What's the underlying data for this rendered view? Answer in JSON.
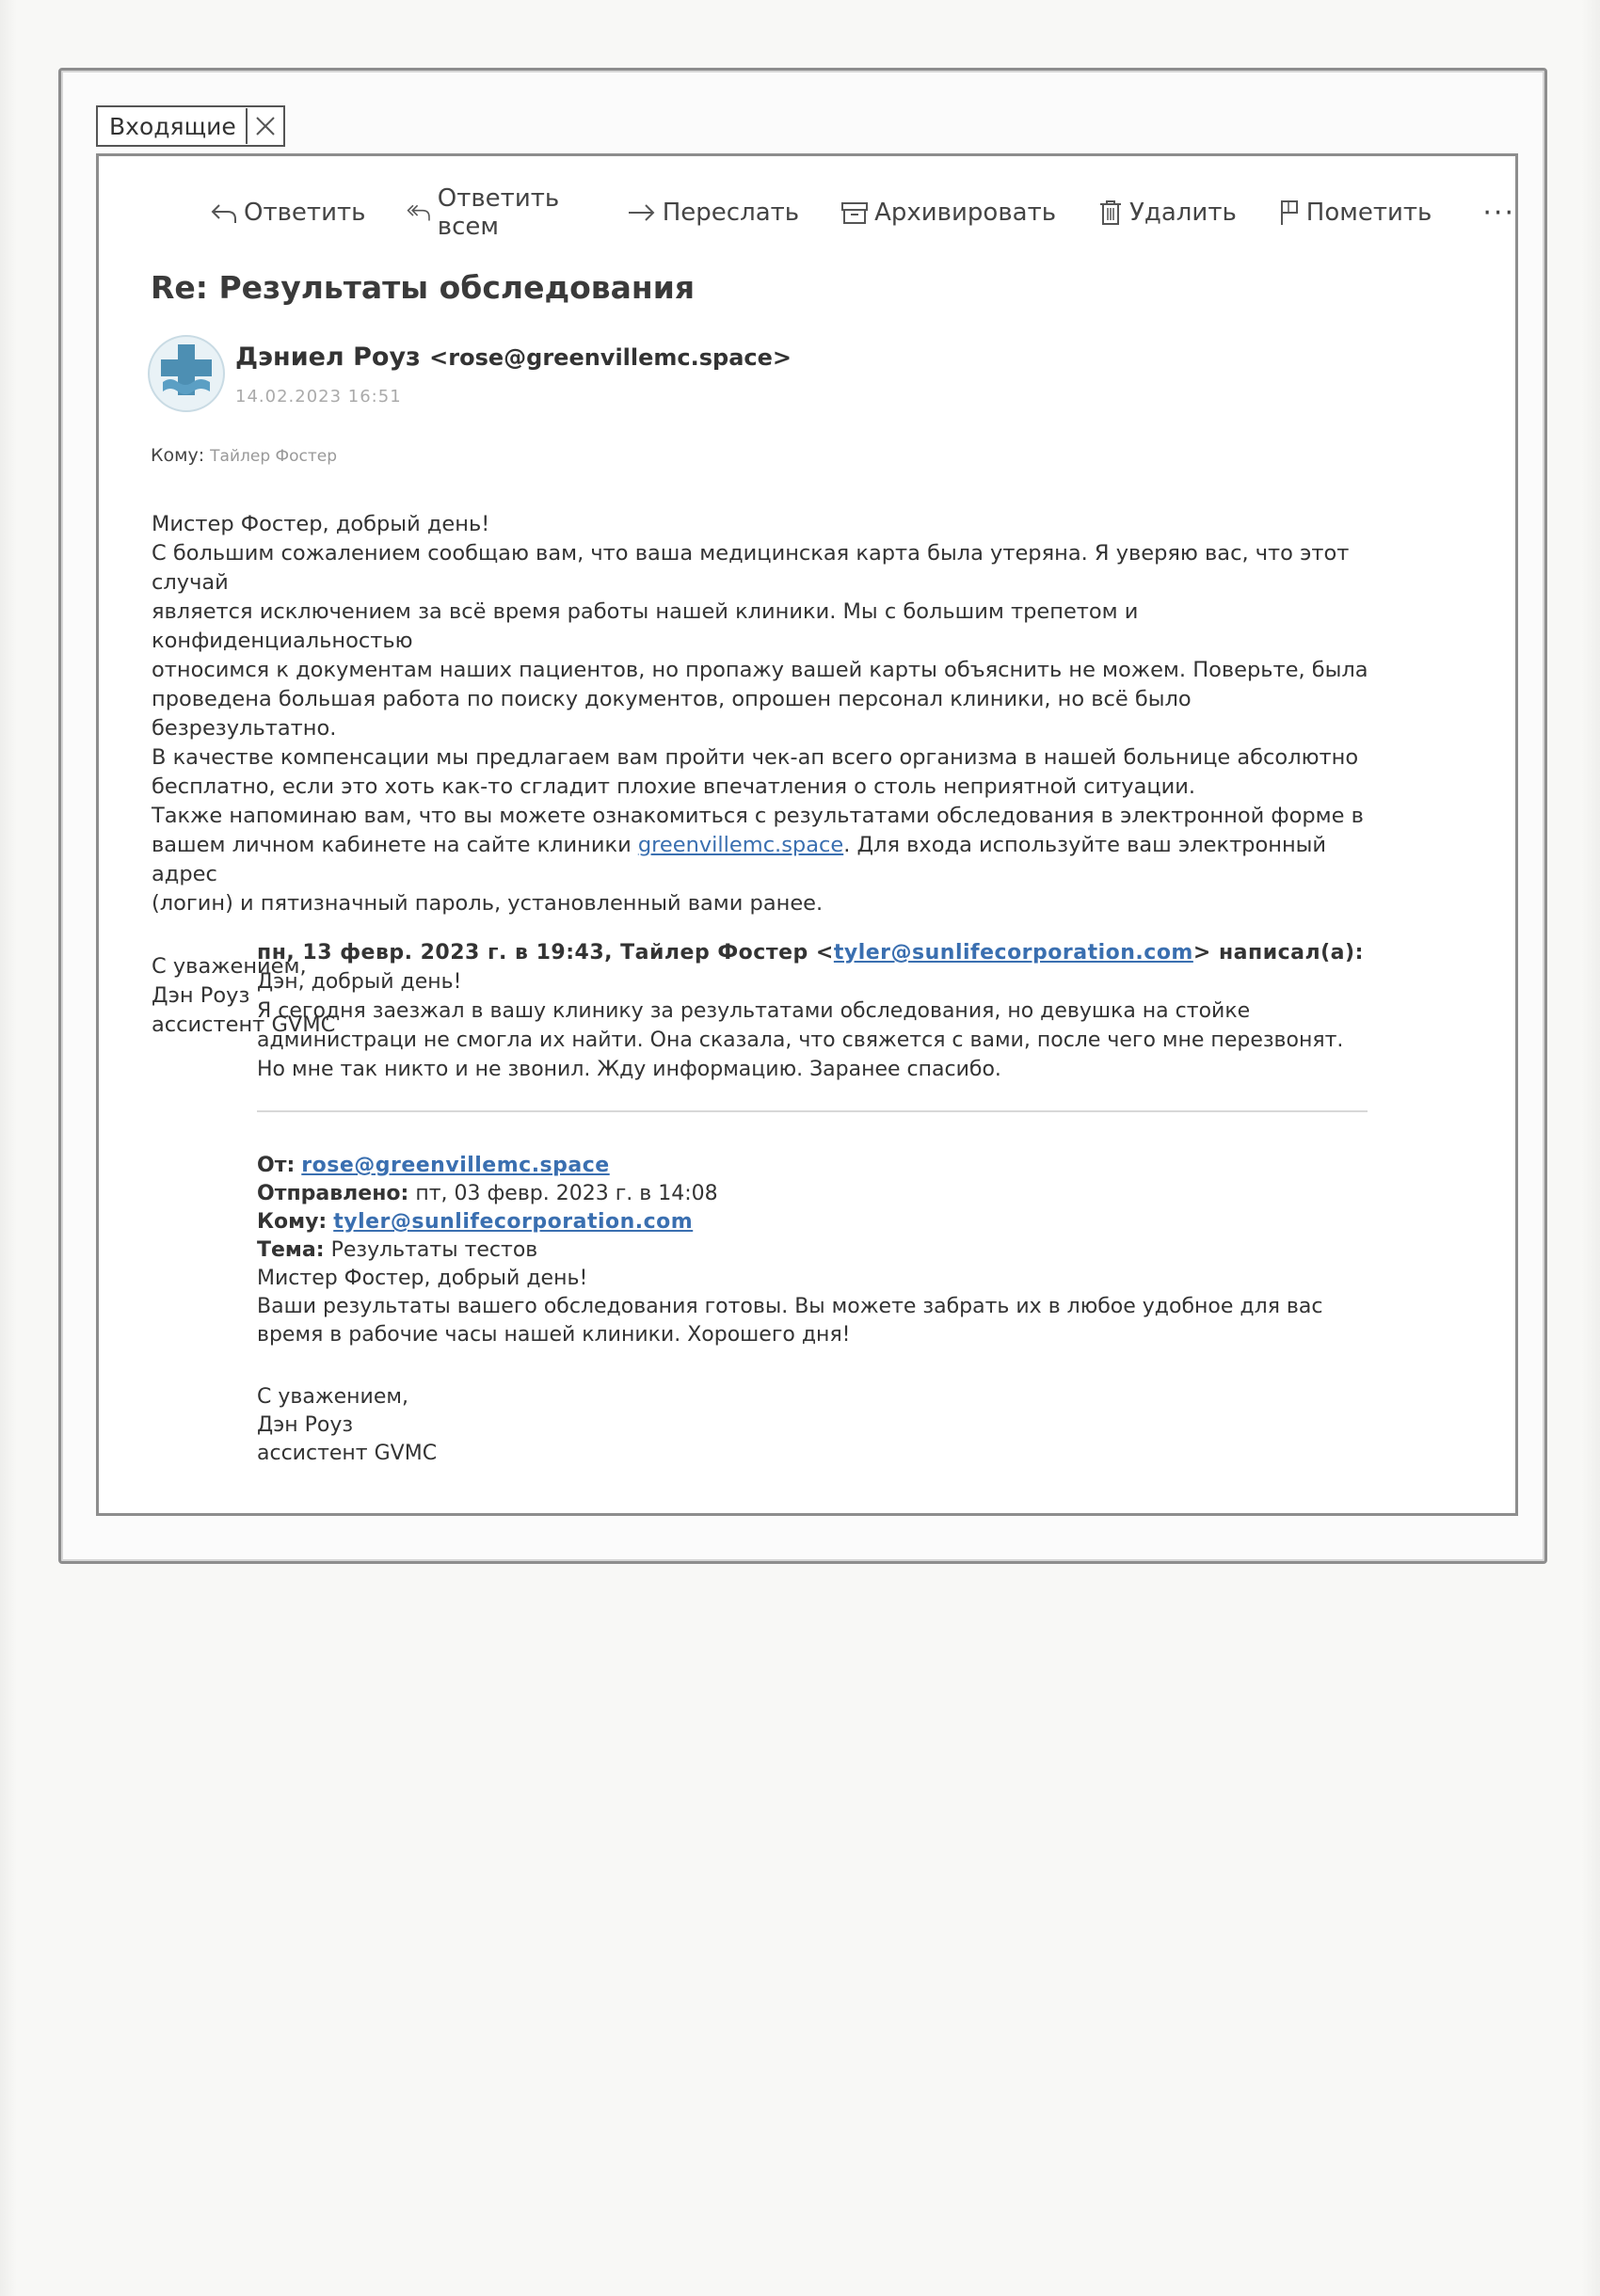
{
  "tab": {
    "label": "Входящие"
  },
  "toolbar": {
    "reply": "Ответить",
    "reply_all": "Ответить всем",
    "forward": "Переслать",
    "archive": "Архивировать",
    "delete": "Удалить",
    "flag": "Пометить",
    "more": "···"
  },
  "message": {
    "subject": "Re: Результаты обследования",
    "sender_name": "Дэниел Роуз",
    "sender_email": "<rose@greenvillemc.space>",
    "date": "14.02.2023  16:51",
    "to_label": "Кому:",
    "to_name": "Тайлер Фостер",
    "greeting": "Мистер Фостер, добрый день!",
    "paragraph1_l1": "С большим сожалением сообщаю вам, что ваша медицинская карта была утеряна. Я уверяю вас, что этот случай",
    "paragraph1_l2": "является исключением за всё время работы нашей клиники. Мы с большим трепетом и конфиденциальностью",
    "paragraph1_l3": "относимся к документам наших пациентов, но пропажу вашей карты объяснить не можем. Поверьте, была",
    "paragraph1_l4": "проведена большая работа по поиску документов, опрошен персонал клиники, но всё было безрезультатно.",
    "paragraph2_l1": "В качестве компенсации мы предлагаем вам пройти чек-ап всего организма в нашей больнице абсолютно",
    "paragraph2_l2": "бесплатно, если это хоть как-то сгладит плохие впечатления о столь неприятной ситуации.",
    "paragraph3_l1": "Также напоминаю вам, что вы можете ознакомиться с результатами обследования в электронной форме в",
    "paragraph3_l2_pre": "вашем личном кабинете на сайте клиники ",
    "paragraph3_link": "greenvillemc.space",
    "paragraph3_l2_post": ". Для входа используйте ваш электронный адрес",
    "paragraph3_l3": "(логин) и пятизначный пароль, установленный вами ранее.",
    "sign_1": "С уважением,",
    "sign_2": "Дэн Роуз",
    "sign_3": "ассистент GVMC"
  },
  "quoted": {
    "header_pre": "пн, 13 февр. 2023 г. в 19:43, Тайлер Фостер <",
    "header_email": "tyler@sunlifecorporation.com",
    "header_post": "> написал(а):",
    "line1": "Дэн, добрый день!",
    "line2": "Я сегодня заезжал в вашу клинику за результатами обследования, но девушка на стойке",
    "line3": "администраци не смогла их найти. Она сказала, что свяжется с вами, после чего мне перезвонят.",
    "line4": "Но мне так никто и не звонил. Жду информацию. Заранее спасибо."
  },
  "forwarded": {
    "from_label": "От:",
    "from_email": "rose@greenvillemc.space",
    "sent_label": "Отправлено:",
    "sent_value": "пт, 03 февр. 2023 г. в 14:08",
    "to_label": "Кому:",
    "to_email": "tyler@sunlifecorporation.com",
    "subject_label": "Тема:",
    "subject_value": "Результаты тестов",
    "greeting": "Мистер Фостер, добрый день!",
    "line1": "Ваши результаты вашего обследования готовы. Вы можете забрать их в любое удобное для вас",
    "line2": "время в рабочие часы нашей клиники. Хорошего дня!",
    "sign_1": "С уважением,",
    "sign_2": "Дэн Роуз",
    "sign_3": "ассистент GVMC"
  },
  "colors": {
    "link": "#3a6fb0",
    "avatar_cross": "#4d8fb3"
  }
}
